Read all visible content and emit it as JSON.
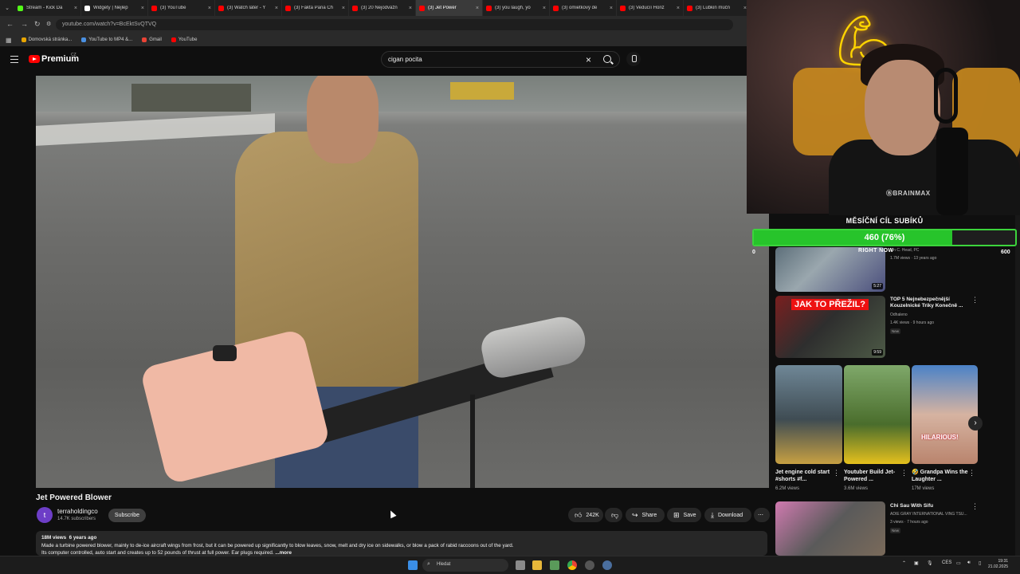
{
  "browser": {
    "tabs": [
      {
        "label": "Stream - Kick Da",
        "color": "#53fc18"
      },
      {
        "label": "Widgety | Nejlep",
        "color": "#ffffff"
      },
      {
        "label": "(3) YouTube",
        "color": "#ff0000"
      },
      {
        "label": "(3) Watch later - Y",
        "color": "#ff0000"
      },
      {
        "label": "(3) Fakta Pana Ch",
        "color": "#ff0000"
      },
      {
        "label": "(3) 20 Nejodvážn",
        "color": "#ff0000"
      },
      {
        "label": "(3) Jet Power",
        "color": "#ff0000",
        "active": true
      },
      {
        "label": "(3) you laugh, yo",
        "color": "#ff0000"
      },
      {
        "label": "(3) omietkový de",
        "color": "#ff0000"
      },
      {
        "label": "(3) Veducíí Horiz",
        "color": "#ff0000"
      },
      {
        "label": "(3) Lubkin múčn",
        "color": "#ff0000"
      }
    ],
    "url": "youtube.com/watch?v=BcEktSvQTVQ",
    "bookmarks": [
      {
        "label": "Domovská stránka...",
        "color": "#e8a500"
      },
      {
        "label": "YouTube to MP4 &...",
        "color": "#4a90e2"
      },
      {
        "label": "Gmail",
        "color": "#ea4335"
      },
      {
        "label": "YouTube",
        "color": "#ff0000"
      }
    ]
  },
  "youtube": {
    "logo_text": "Premium",
    "country": "CZ",
    "search_value": "cigan pocita",
    "video": {
      "title": "Jet Powered Blower",
      "channel": "terraholdingco",
      "avatar_letter": "t",
      "subscribers": "14.7K subscribers",
      "subscribe_label": "Subscribe",
      "likes": "242K",
      "share_label": "Share",
      "save_label": "Save",
      "download_label": "Download",
      "views": "18M views",
      "age": "6 years ago",
      "description_line1": "Made a turbine powered blower, mainly to de-ice aircraft wings from frost, but it can be powered up significantly to blow leaves, snow, melt and dry ice on sidewalks, or blow a pack of rabid raccoons out of the yard.",
      "description_line2": "Its computer controlled, auto start and creates up to 52 pounds of thrust at full power. Ear plugs required.",
      "more_label": "...more"
    },
    "related": [
      {
        "title": "",
        "meta1": "...n C. Head, PC",
        "meta2": "1.7M views · 13 years ago",
        "duration": "5:27"
      },
      {
        "title": "TOP 5 Nejnebezpečnější Kouzelnické Triky Konečně ...",
        "meta1": "Odhaleno",
        "meta2": "1.4K views · 9 hours ago",
        "badge": "New",
        "duration": "9:59",
        "thumb_text": "JAK TO PŘEŽIL?"
      },
      {
        "title": "Chi Sau With Sifu",
        "meta1": "ADIE GRAY INTERNATIONAL VING TSU...",
        "meta2": "3 views · 7 hours ago",
        "badge": "New"
      }
    ],
    "shorts": [
      {
        "title": "Jet engine cold start #shorts #f...",
        "views": "6.2M views"
      },
      {
        "title": "Youtuber Build Jet-Powered ...",
        "views": "3.6M views"
      },
      {
        "title": "🤣 Grandpa Wins the Laughter ...",
        "views": "17M views",
        "thumb_text": "HILARIOUS!"
      }
    ],
    "overlay_text": "RIGHT NOW"
  },
  "stream": {
    "goal_title": "MĚSÍČNÍ CÍL SUBÍKŮ",
    "goal_text": "460 (76%)",
    "goal_fraction": 0.76,
    "goal_min": "0",
    "goal_max": "600",
    "shirt_brand": "ⒷBRAINMAX"
  },
  "taskbar": {
    "search_placeholder": "Hledat",
    "language": "CES",
    "time": "19:31",
    "date": "21.02.2025"
  }
}
